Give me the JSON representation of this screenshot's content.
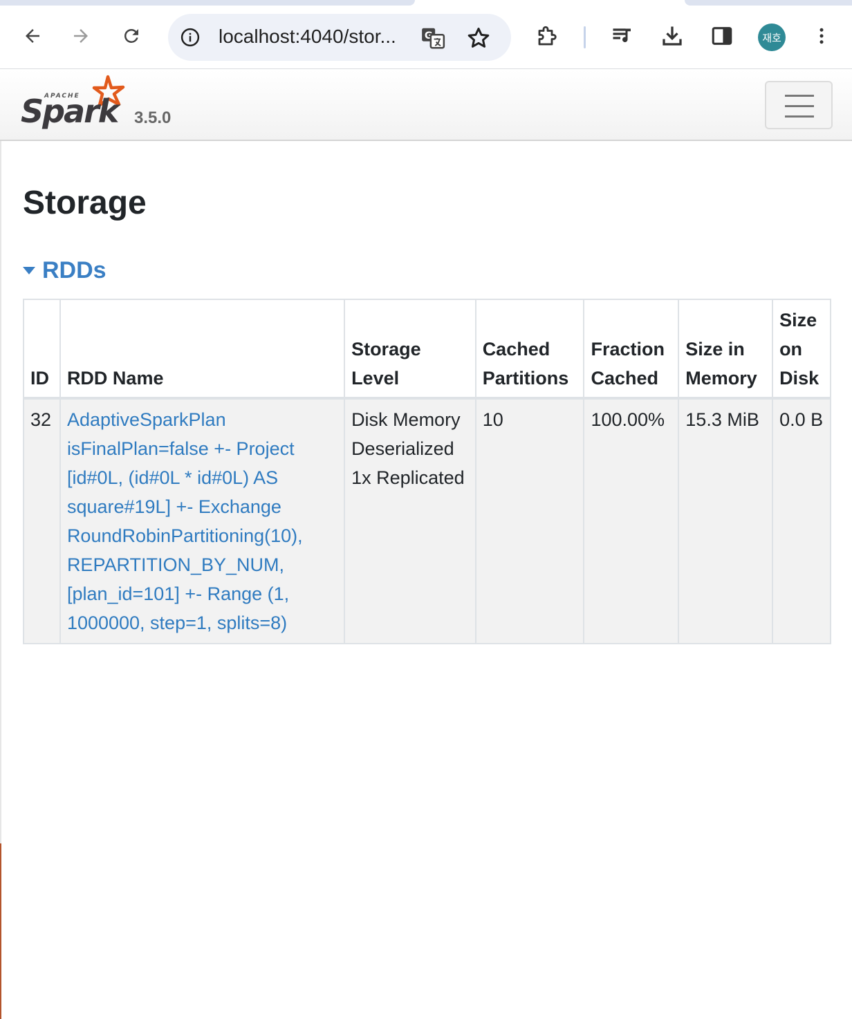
{
  "browser": {
    "url": "localhost:4040/stor...",
    "profile_initials": "재호"
  },
  "navbar": {
    "brand": "Spark",
    "brand_prefix": "APACHE",
    "version": "3.5.0"
  },
  "page": {
    "title": "Storage",
    "section_label": "RDDs"
  },
  "table": {
    "headers": {
      "id": "ID",
      "rdd_name": "RDD Name",
      "storage_level": "Storage Level",
      "cached_partitions": "Cached Partitions",
      "fraction_cached": "Fraction Cached",
      "size_in_memory": "Size in Memory",
      "size_on_disk": "Size on Disk"
    },
    "rows": [
      {
        "id": "32",
        "rdd_name": "AdaptiveSparkPlan isFinalPlan=false +- Project [id#0L, (id#0L * id#0L) AS square#19L] +- Exchange RoundRobinPartitioning(10), REPARTITION_BY_NUM, [plan_id=101] +- Range (1, 1000000, step=1, splits=8)",
        "storage_level": "Disk Memory Deserialized 1x Replicated",
        "cached_partitions": "10",
        "fraction_cached": "100.00%",
        "size_in_memory": "15.3 MiB",
        "size_on_disk": "0.0 B"
      }
    ]
  },
  "colors": {
    "link": "#2f7bc0",
    "spark_orange": "#e25a1c",
    "avatar": "#2f8a96"
  }
}
